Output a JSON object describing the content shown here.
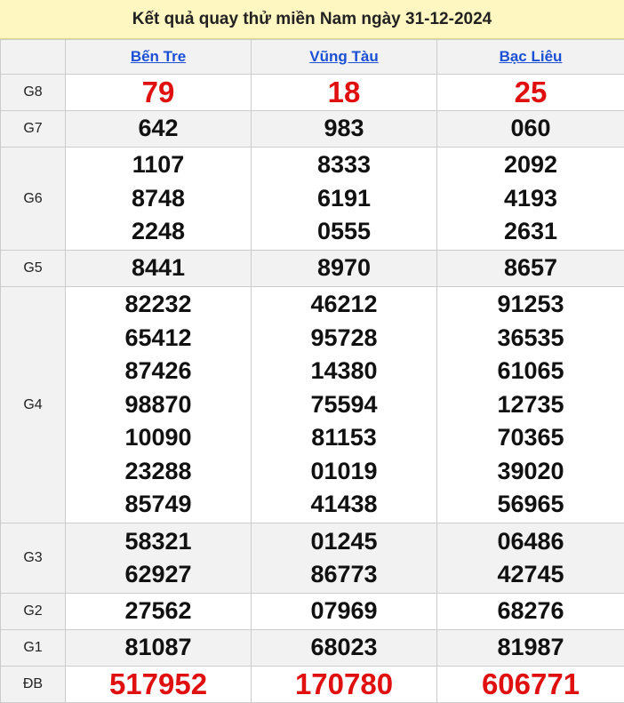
{
  "title": "Kết quả quay thử miền Nam ngày 31-12-2024",
  "provinces": [
    "Bến Tre",
    "Vũng Tàu",
    "Bạc Liêu"
  ],
  "rows": [
    {
      "label": "G8",
      "red": true,
      "values": [
        [
          "79"
        ],
        [
          "18"
        ],
        [
          "25"
        ]
      ]
    },
    {
      "label": "G7",
      "red": false,
      "values": [
        [
          "642"
        ],
        [
          "983"
        ],
        [
          "060"
        ]
      ]
    },
    {
      "label": "G6",
      "red": false,
      "values": [
        [
          "1107",
          "8748",
          "2248"
        ],
        [
          "8333",
          "6191",
          "0555"
        ],
        [
          "2092",
          "4193",
          "2631"
        ]
      ]
    },
    {
      "label": "G5",
      "red": false,
      "values": [
        [
          "8441"
        ],
        [
          "8970"
        ],
        [
          "8657"
        ]
      ]
    },
    {
      "label": "G4",
      "red": false,
      "values": [
        [
          "82232",
          "65412",
          "87426",
          "98870",
          "10090",
          "23288",
          "85749"
        ],
        [
          "46212",
          "95728",
          "14380",
          "75594",
          "81153",
          "01019",
          "41438"
        ],
        [
          "91253",
          "36535",
          "61065",
          "12735",
          "70365",
          "39020",
          "56965"
        ]
      ]
    },
    {
      "label": "G3",
      "red": false,
      "values": [
        [
          "58321",
          "62927"
        ],
        [
          "01245",
          "86773"
        ],
        [
          "06486",
          "42745"
        ]
      ]
    },
    {
      "label": "G2",
      "red": false,
      "values": [
        [
          "27562"
        ],
        [
          "07969"
        ],
        [
          "68276"
        ]
      ]
    },
    {
      "label": "G1",
      "red": false,
      "values": [
        [
          "81087"
        ],
        [
          "68023"
        ],
        [
          "81987"
        ]
      ]
    },
    {
      "label": "ĐB",
      "red": true,
      "values": [
        [
          "517952"
        ],
        [
          "170780"
        ],
        [
          "606771"
        ]
      ]
    }
  ],
  "colors": {
    "title_bg": "#fff7c2",
    "link": "#1a4fd6",
    "red": "#e01010",
    "alt_row": "#f2f2f2"
  }
}
